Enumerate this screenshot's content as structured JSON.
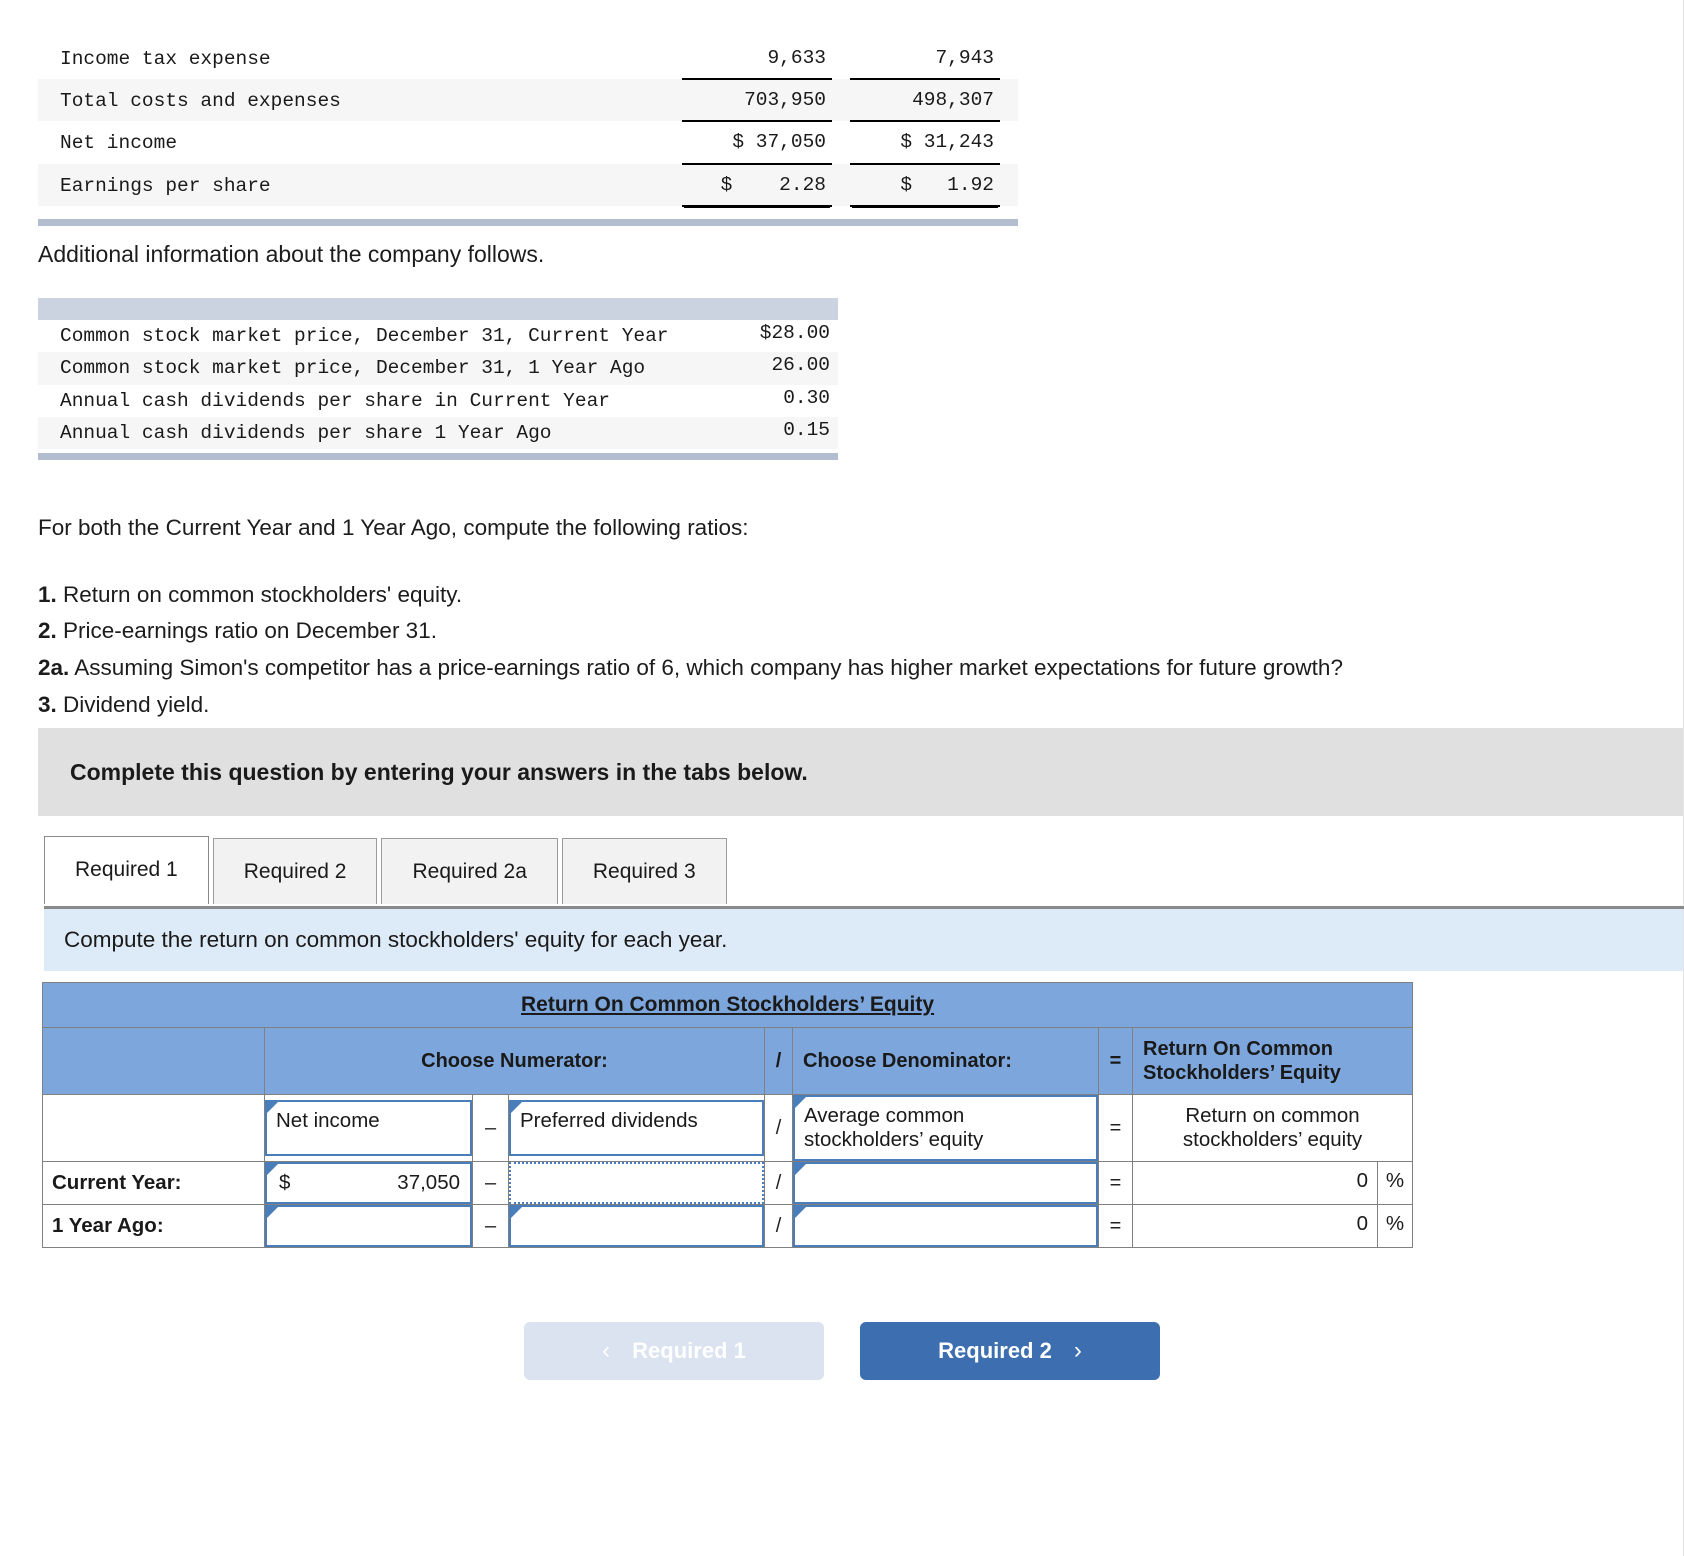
{
  "statement": {
    "rows": [
      {
        "label": "Income tax expense",
        "current": "9,633",
        "prior": "7,943",
        "style": "single-underline"
      },
      {
        "label": "Total costs and expenses",
        "current": "703,950",
        "prior": "498,307",
        "style": "single-underline-shaded"
      },
      {
        "label": "Net income",
        "current": "$ 37,050",
        "prior": "$ 31,243",
        "style": "double-underline"
      },
      {
        "label": "Earnings per share",
        "current": "$    2.28",
        "prior": "$   1.92",
        "style": "double-underline-shaded"
      }
    ]
  },
  "additional_intro": "Additional information about the company follows.",
  "additional_info": {
    "rows": [
      {
        "label": "Common stock market price, December 31, Current Year",
        "value": "$28.00"
      },
      {
        "label": "Common stock market price, December 31, 1 Year Ago",
        "value": "26.00"
      },
      {
        "label": "Annual cash dividends per share in Current Year",
        "value": "0.30"
      },
      {
        "label": "Annual cash dividends per share 1 Year Ago",
        "value": "0.15"
      }
    ]
  },
  "instructions": {
    "lead": "For both the Current Year and 1 Year Ago, compute the following ratios:",
    "items": [
      {
        "num": "1.",
        "text": "Return on common stockholders' equity."
      },
      {
        "num": "2.",
        "text": "Price-earnings ratio on December 31."
      },
      {
        "num": "2a.",
        "text": "Assuming Simon's competitor has a price-earnings ratio of 6, which company has higher market expectations for future growth?"
      },
      {
        "num": "3.",
        "text": "Dividend yield."
      }
    ]
  },
  "banner": "Complete this question by entering your answers in the tabs below.",
  "tabs": [
    {
      "label": "Required 1",
      "active": true
    },
    {
      "label": "Required 2",
      "active": false
    },
    {
      "label": "Required 2a",
      "active": false
    },
    {
      "label": "Required 3",
      "active": false
    }
  ],
  "prompt": "Compute the return on common stockholders' equity for each year.",
  "answer_table": {
    "title": "Return On Common Stockholders’ Equity",
    "headers": {
      "corner": "",
      "numerator": "Choose Numerator:",
      "divide": "/",
      "denominator": "Choose Denominator:",
      "equals": "=",
      "result": "Return On Common Stockholders’ Equity"
    },
    "formula_row": {
      "label": "",
      "numerator": "Net income",
      "minus": "–",
      "subtrahend": "Preferred dividends",
      "divide": "/",
      "denominator": "Average common stockholders’ equity",
      "equals": "=",
      "result": "Return on common stockholders’ equity"
    },
    "rows": [
      {
        "label": "Current Year:",
        "numerator_symbol": "$",
        "numerator_value": "37,050",
        "minus": "–",
        "subtrahend": "",
        "divide": "/",
        "denominator": "",
        "equals": "=",
        "result_value": "0",
        "result_unit": "%"
      },
      {
        "label": "1 Year Ago:",
        "numerator_symbol": "",
        "numerator_value": "",
        "minus": "–",
        "subtrahend": "",
        "divide": "/",
        "denominator": "",
        "equals": "=",
        "result_value": "0",
        "result_unit": "%"
      }
    ]
  },
  "nav": {
    "prev_label": "Required 1",
    "prev_chevron": "‹",
    "next_label": "Required 2",
    "next_chevron": "›"
  },
  "colors": {
    "header_blue": "#7da7dc",
    "prompt_blue": "#ddeaf7",
    "select_border": "#4a7ebb",
    "next_button": "#3c6eb0",
    "prev_button": "#dae3ef",
    "banner_grey": "#e0e0e0",
    "rule_blue": "#b3bdd0"
  }
}
